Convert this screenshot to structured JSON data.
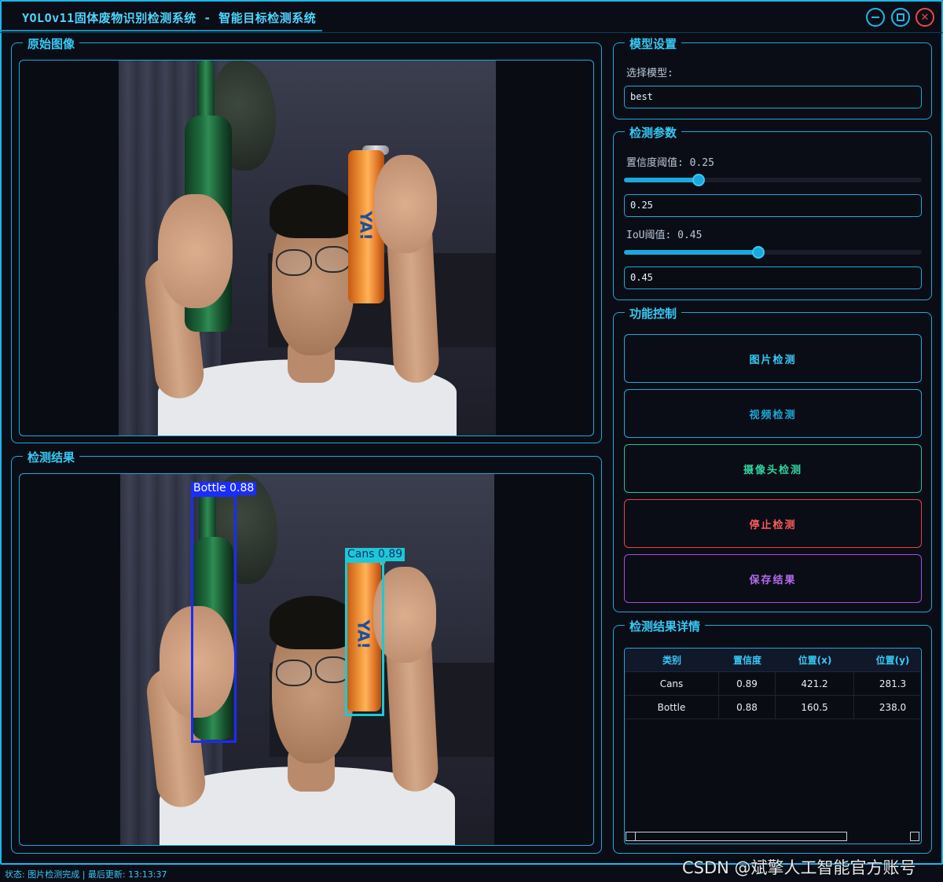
{
  "window": {
    "title": "YOLOv11固体废物识别检测系统 - 智能目标检测系统",
    "minimize_icon": "minimize-icon",
    "maximize_icon": "maximize-icon",
    "close_icon": "close-icon",
    "accent_color": "#1da9d8"
  },
  "original_panel": {
    "title": "原始图像"
  },
  "result_panel": {
    "title": "检测结果",
    "detections": [
      {
        "label": "Bottle 0.88"
      },
      {
        "label": "Cans 0.89"
      }
    ],
    "can_text": "YA!"
  },
  "model_settings": {
    "title": "模型设置",
    "select_label": "选择模型:",
    "model_value": "best"
  },
  "detection_params": {
    "title": "检测参数",
    "confidence_label": "置信度阈值: 0.25",
    "confidence_value": "0.25",
    "confidence_level": 0.25,
    "iou_label": "IoU阈值: 0.45",
    "iou_value": "0.45",
    "iou_level": 0.45
  },
  "function_control": {
    "title": "功能控制",
    "image_detect": "图片检测",
    "video_detect": "视频检测",
    "camera_detect": "摄像头检测",
    "stop_detect": "停止检测",
    "save_results": "保存结果"
  },
  "results_detail": {
    "title": "检测结果详情",
    "columns": [
      "类别",
      "置信度",
      "位置(x)",
      "位置(y)"
    ],
    "rows": [
      [
        "Cans",
        "0.89",
        "421.2",
        "281.3"
      ],
      [
        "Bottle",
        "0.88",
        "160.5",
        "238.0"
      ]
    ]
  },
  "status": {
    "text": "状态: 图片检测完成 | 最后更新: 13:13:37"
  },
  "watermark": "CSDN @斌擎人工智能官方账号"
}
